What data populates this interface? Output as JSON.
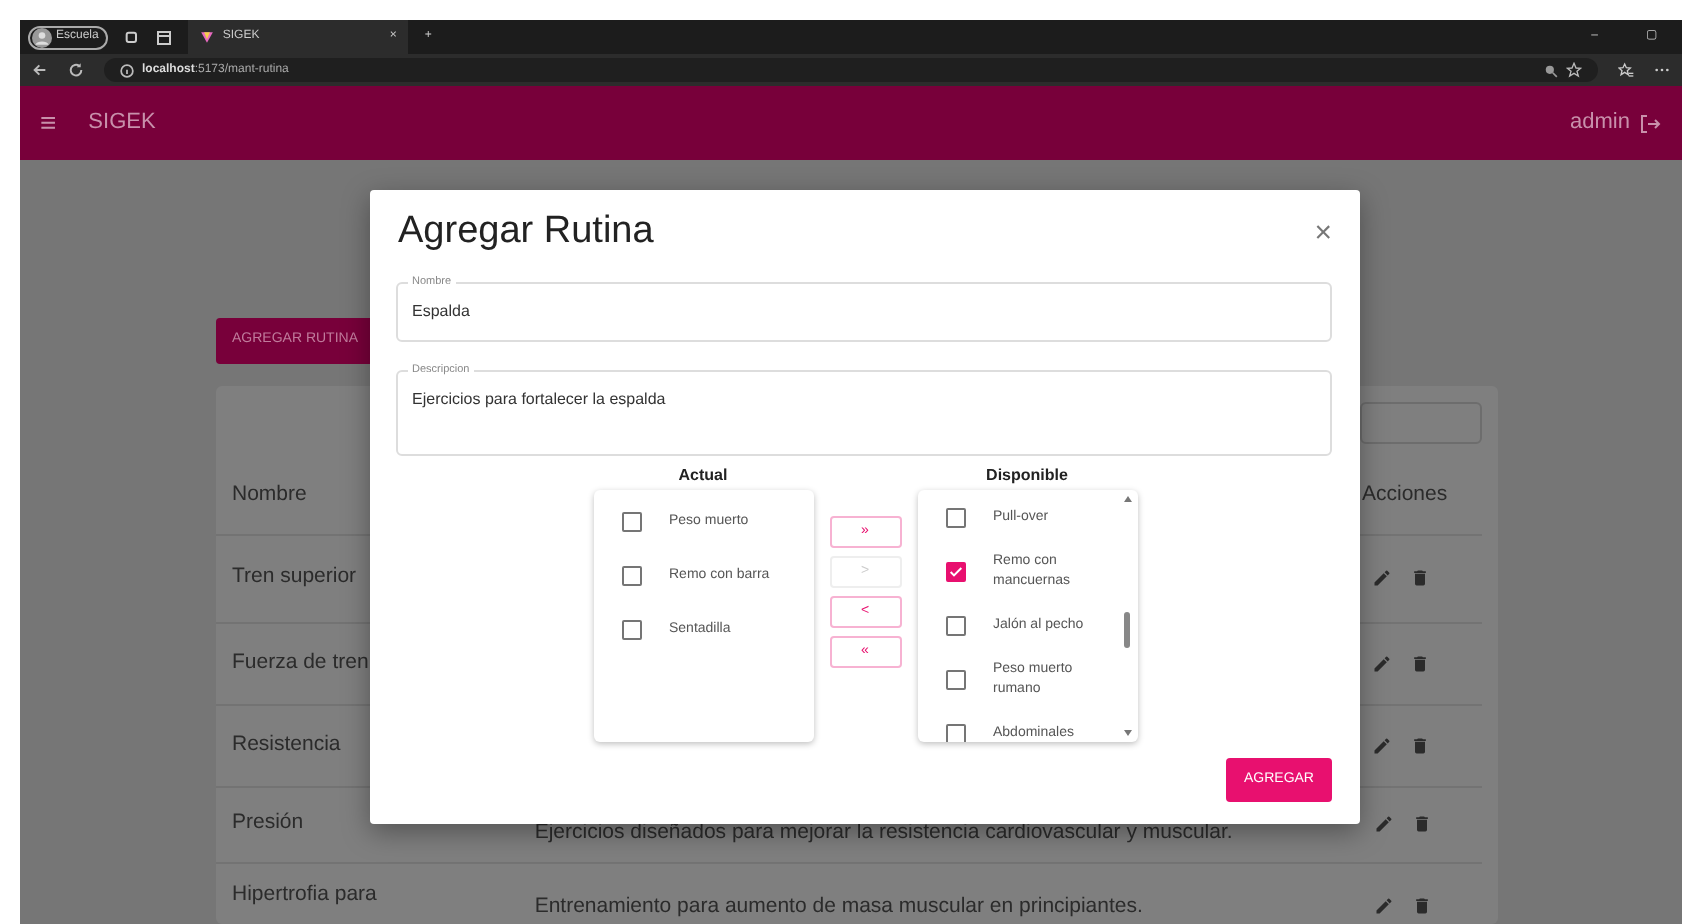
{
  "browser": {
    "profile": "Escuela",
    "tab_title": "SIGEK",
    "tab_close": "×",
    "new_tab": "+",
    "url_host": "localhost",
    "url_path": ":5173/mant-rutina",
    "window_controls": [
      "–",
      "▢"
    ]
  },
  "app": {
    "menu_glyph": "≡",
    "brand": "SIGEK",
    "user": "admin"
  },
  "add_button": "AGREGAR RUTINA",
  "table": {
    "columns": [
      "Nombre",
      "Acciones"
    ],
    "rows": [
      {
        "name": "Tren superior",
        "description": ""
      },
      {
        "name": "Fuerza de tren",
        "description": ""
      },
      {
        "name": "Resistencia",
        "description": ""
      },
      {
        "name": "Presión",
        "description": "Ejercicios diseñados para mejorar la resistencia cardiovascular y muscular."
      },
      {
        "name": "Hipertrofia para",
        "description": "Entrenamiento para aumento de masa muscular en principiantes."
      }
    ]
  },
  "modal": {
    "title": "Agregar Rutina",
    "close": "×",
    "fields": [
      {
        "label": "Nombre",
        "value": "Espalda",
        "kind": "input"
      },
      {
        "label": "Descripcion",
        "value": "Ejercicios para fortalecer la espalda",
        "kind": "textarea"
      }
    ],
    "actual": {
      "title": "Actual",
      "items": [
        {
          "label": "Peso muerto",
          "checked": false
        },
        {
          "label": "Remo con barra",
          "checked": false
        },
        {
          "label": "Sentadilla",
          "checked": false
        }
      ]
    },
    "move_buttons": [
      {
        "label": "»",
        "disabled": false
      },
      {
        "label": ">",
        "disabled": true
      },
      {
        "label": "<",
        "disabled": false
      },
      {
        "label": "«",
        "disabled": false
      }
    ],
    "disponible": {
      "title": "Disponible",
      "items": [
        {
          "label": "Pull-over",
          "checked": false
        },
        {
          "label": "Remo con mancuernas",
          "checked": true
        },
        {
          "label": "Jalón al pecho",
          "checked": false
        },
        {
          "label": "Peso muerto rumano",
          "checked": false
        },
        {
          "label": "Abdominales",
          "checked": false
        }
      ]
    },
    "submit": "AGREGAR"
  }
}
